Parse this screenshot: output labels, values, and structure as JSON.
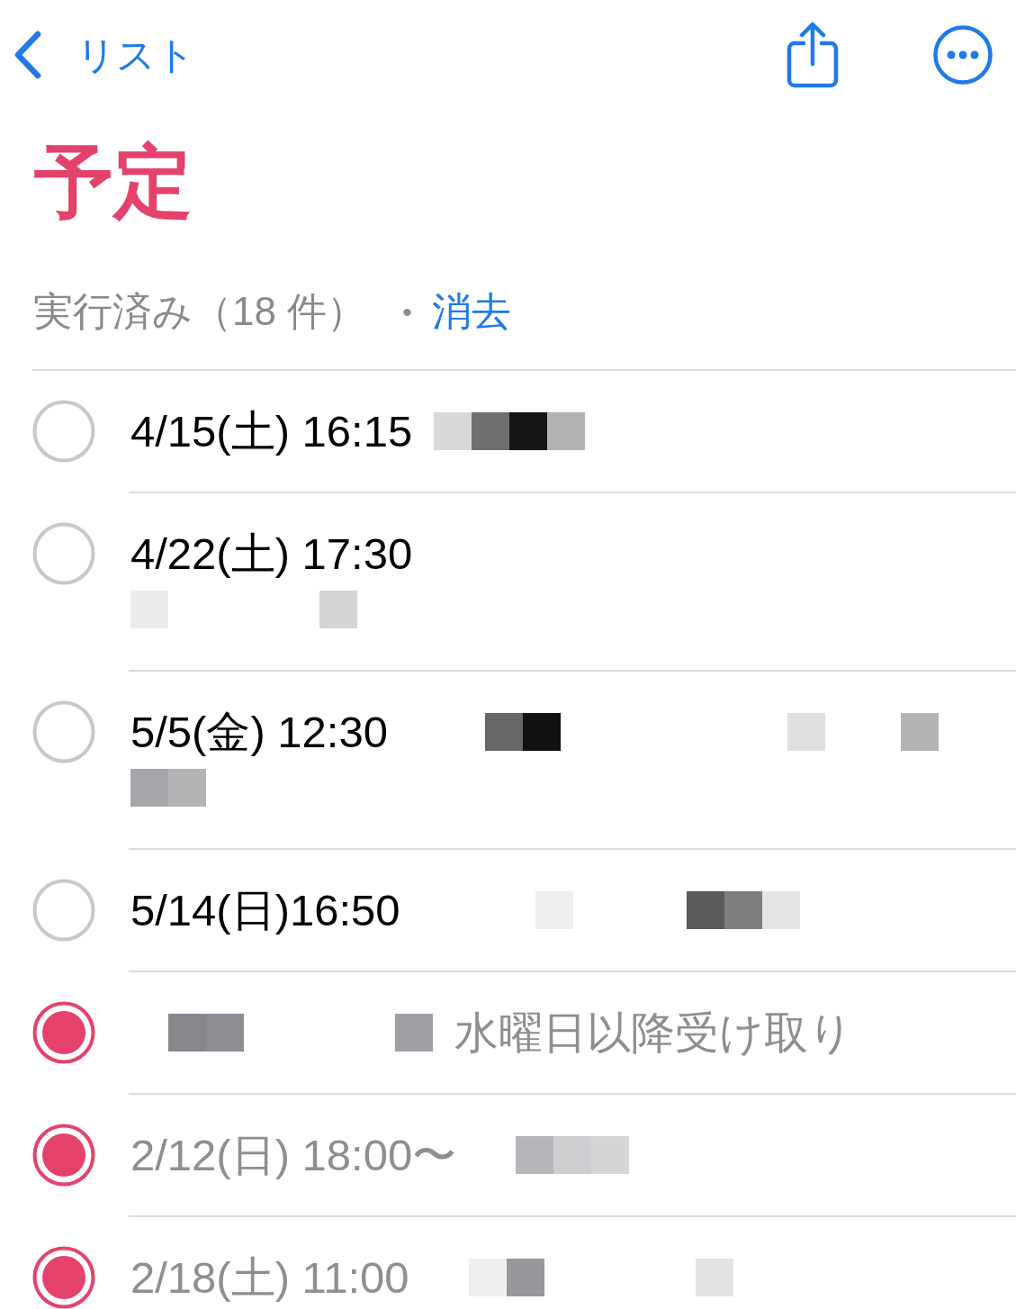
{
  "nav": {
    "back_label": "リスト"
  },
  "title": "予定",
  "completed_summary": {
    "count_text": "実行済み（18 件）",
    "separator": "•",
    "clear_label": "消去"
  },
  "reminders": [
    {
      "completed": false,
      "lines": [
        {
          "parts": [
            {
              "kind": "text",
              "text": "4/15(土) 16:15"
            },
            {
              "kind": "mosaic",
              "cells": [
                {
                  "kind": "tile",
                  "color": "#d9d9d9"
                },
                {
                  "kind": "tile",
                  "color": "#6f6f6f"
                },
                {
                  "kind": "tile",
                  "color": "#151515"
                },
                {
                  "kind": "tile",
                  "color": "#b3b3b3"
                }
              ]
            }
          ]
        }
      ]
    },
    {
      "completed": false,
      "lines": [
        {
          "parts": [
            {
              "kind": "text",
              "text": "4/22(土) 17:30"
            }
          ]
        },
        {
          "parts": [
            {
              "kind": "mosaic",
              "cells": [
                {
                  "kind": "tile",
                  "color": "#ececec"
                },
                {
                  "kind": "blank"
                },
                {
                  "kind": "blank"
                },
                {
                  "kind": "blank"
                },
                {
                  "kind": "blank"
                },
                {
                  "kind": "tile",
                  "color": "#d5d5d7"
                }
              ]
            }
          ]
        }
      ]
    },
    {
      "completed": false,
      "lines": [
        {
          "parts": [
            {
              "kind": "text",
              "text": "5/5(金) 12:30"
            },
            {
              "kind": "mosaic",
              "cells": [
                {
                  "kind": "blank"
                },
                {
                  "kind": "blank"
                },
                {
                  "kind": "tile",
                  "color": "#666666"
                },
                {
                  "kind": "tile",
                  "color": "#111111"
                },
                {
                  "kind": "blank"
                },
                {
                  "kind": "blank"
                },
                {
                  "kind": "blank"
                },
                {
                  "kind": "blank"
                },
                {
                  "kind": "blank"
                },
                {
                  "kind": "blank"
                },
                {
                  "kind": "tile",
                  "color": "#e0e0e0"
                },
                {
                  "kind": "blank"
                },
                {
                  "kind": "blank"
                },
                {
                  "kind": "tile",
                  "color": "#b4b4b4"
                }
              ]
            }
          ]
        },
        {
          "parts": [
            {
              "kind": "mosaic",
              "cells": [
                {
                  "kind": "tile",
                  "color": "#a6a6aa"
                },
                {
                  "kind": "tile",
                  "color": "#b4b4b6"
                }
              ]
            }
          ]
        }
      ]
    },
    {
      "completed": false,
      "lines": [
        {
          "parts": [
            {
              "kind": "text",
              "text": "5/14(日)16:50"
            },
            {
              "kind": "mosaic",
              "cells": [
                {
                  "kind": "blank"
                },
                {
                  "kind": "blank"
                },
                {
                  "kind": "blank"
                },
                {
                  "kind": "tile",
                  "color": "#efefef"
                },
                {
                  "kind": "blank"
                },
                {
                  "kind": "blank"
                },
                {
                  "kind": "blank"
                },
                {
                  "kind": "tile",
                  "color": "#5a5a5a"
                },
                {
                  "kind": "tile",
                  "color": "#7e7e7e"
                },
                {
                  "kind": "tile",
                  "color": "#e6e6e6"
                }
              ]
            }
          ]
        }
      ]
    },
    {
      "completed": true,
      "lines": [
        {
          "parts": [
            {
              "kind": "mosaic",
              "cells": [
                {
                  "kind": "blank"
                },
                {
                  "kind": "tile",
                  "color": "#88888c"
                },
                {
                  "kind": "tile",
                  "color": "#8e8e92"
                },
                {
                  "kind": "blank"
                },
                {
                  "kind": "blank"
                },
                {
                  "kind": "blank"
                },
                {
                  "kind": "blank"
                },
                {
                  "kind": "tile",
                  "color": "#a0a0a4"
                }
              ]
            },
            {
              "kind": "text",
              "text": "水曜日以降受け取り"
            }
          ]
        }
      ]
    },
    {
      "completed": true,
      "lines": [
        {
          "parts": [
            {
              "kind": "text",
              "text": "2/12(日) 18:00〜"
            },
            {
              "kind": "mosaic",
              "cells": [
                {
                  "kind": "blank"
                },
                {
                  "kind": "tile",
                  "color": "#b7b6bb"
                },
                {
                  "kind": "tile",
                  "color": "#cfcfd2"
                },
                {
                  "kind": "tile",
                  "color": "#d6d6d8"
                }
              ]
            }
          ]
        }
      ]
    },
    {
      "completed": true,
      "lines": [
        {
          "parts": [
            {
              "kind": "text",
              "text": "2/18(土) 11:00"
            },
            {
              "kind": "mosaic",
              "cells": [
                {
                  "kind": "blank"
                },
                {
                  "kind": "tile",
                  "color": "#efefef"
                },
                {
                  "kind": "tile",
                  "color": "#98989c"
                },
                {
                  "kind": "blank"
                },
                {
                  "kind": "blank"
                },
                {
                  "kind": "blank"
                },
                {
                  "kind": "blank"
                },
                {
                  "kind": "tile",
                  "color": "#e4e4e6"
                }
              ]
            }
          ]
        }
      ]
    }
  ]
}
